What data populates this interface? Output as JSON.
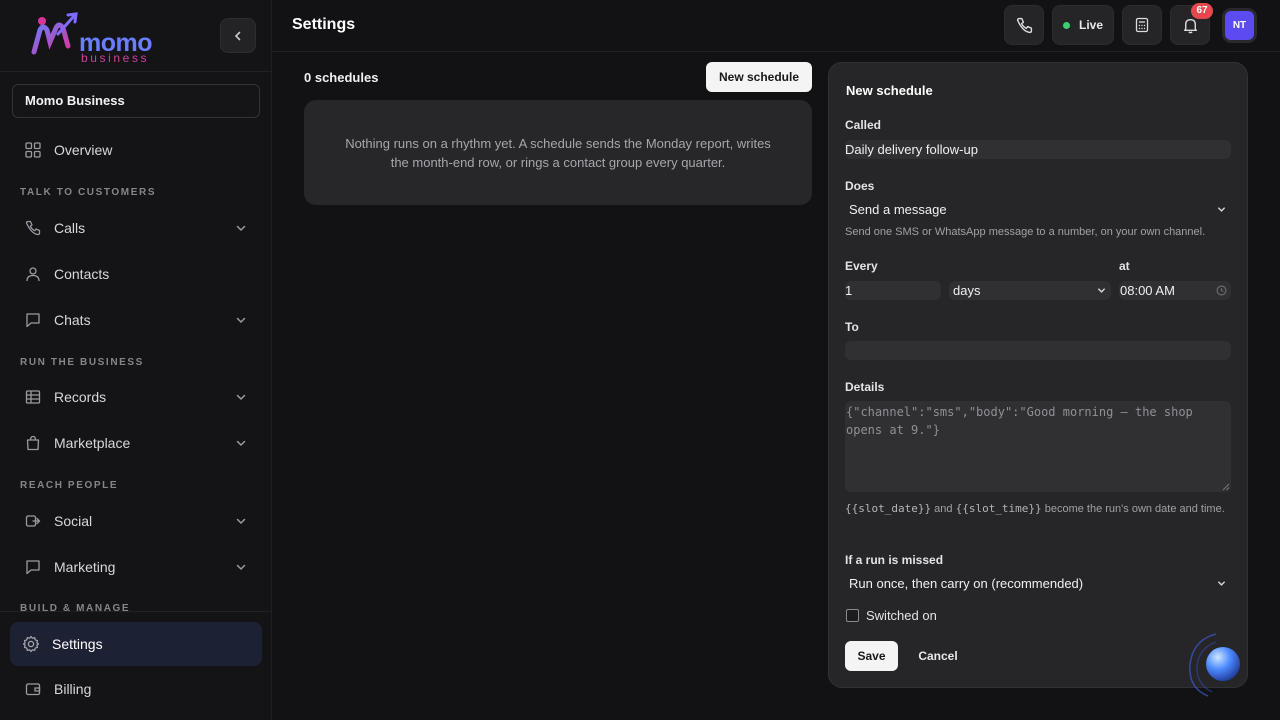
{
  "brand": {
    "name": "momo",
    "sub": "business",
    "accent": "#6a7cff",
    "secondary": "#c9439e"
  },
  "sidebar": {
    "workspace": "Momo Business",
    "overview": "Overview",
    "sections": {
      "talk": "TALK TO CUSTOMERS",
      "run": "RUN THE BUSINESS",
      "reach": "REACH PEOPLE",
      "build": "BUILD & MANAGE"
    },
    "items": {
      "calls": "Calls",
      "contacts": "Contacts",
      "chats": "Chats",
      "records": "Records",
      "marketplace": "Marketplace",
      "social": "Social",
      "marketing": "Marketing",
      "settings": "Settings",
      "billing": "Billing"
    }
  },
  "header": {
    "title": "Settings",
    "live_label": "Live",
    "notifications_count": "67",
    "avatar_initials": "NT",
    "live_color": "#3ecf73",
    "badge_color": "#e5484d",
    "avatar_color": "#5b4bf0"
  },
  "main": {
    "count_label": "0 schedules",
    "new_button": "New schedule",
    "empty_text": "Nothing runs on a rhythm yet. A schedule sends the Monday report, writes the month-end row, or rings a contact group every quarter."
  },
  "form": {
    "title": "New schedule",
    "called_label": "Called",
    "called_value": "Daily delivery follow-up",
    "does_label": "Does",
    "does_value": "Send a message",
    "does_hint": "Send one SMS or WhatsApp message to a number, on your own channel.",
    "every_label": "Every",
    "every_value": "1",
    "unit_value": "days",
    "at_label": "at",
    "time_value": "08:00 AM",
    "to_label": "To",
    "to_value": "",
    "details_label": "Details",
    "details_placeholder": "{\"channel\":\"sms\",\"body\":\"Good morning — the shop opens at 9.\"}",
    "slot_date": "{{slot_date}}",
    "hint_and": "and",
    "slot_time": "{{slot_time}}",
    "hint_suffix": "become the run's own date and time.",
    "missed_label": "If a run is missed",
    "missed_value": "Run once, then carry on (recommended)",
    "switch_label": "Switched on",
    "save_label": "Save",
    "cancel_label": "Cancel"
  }
}
